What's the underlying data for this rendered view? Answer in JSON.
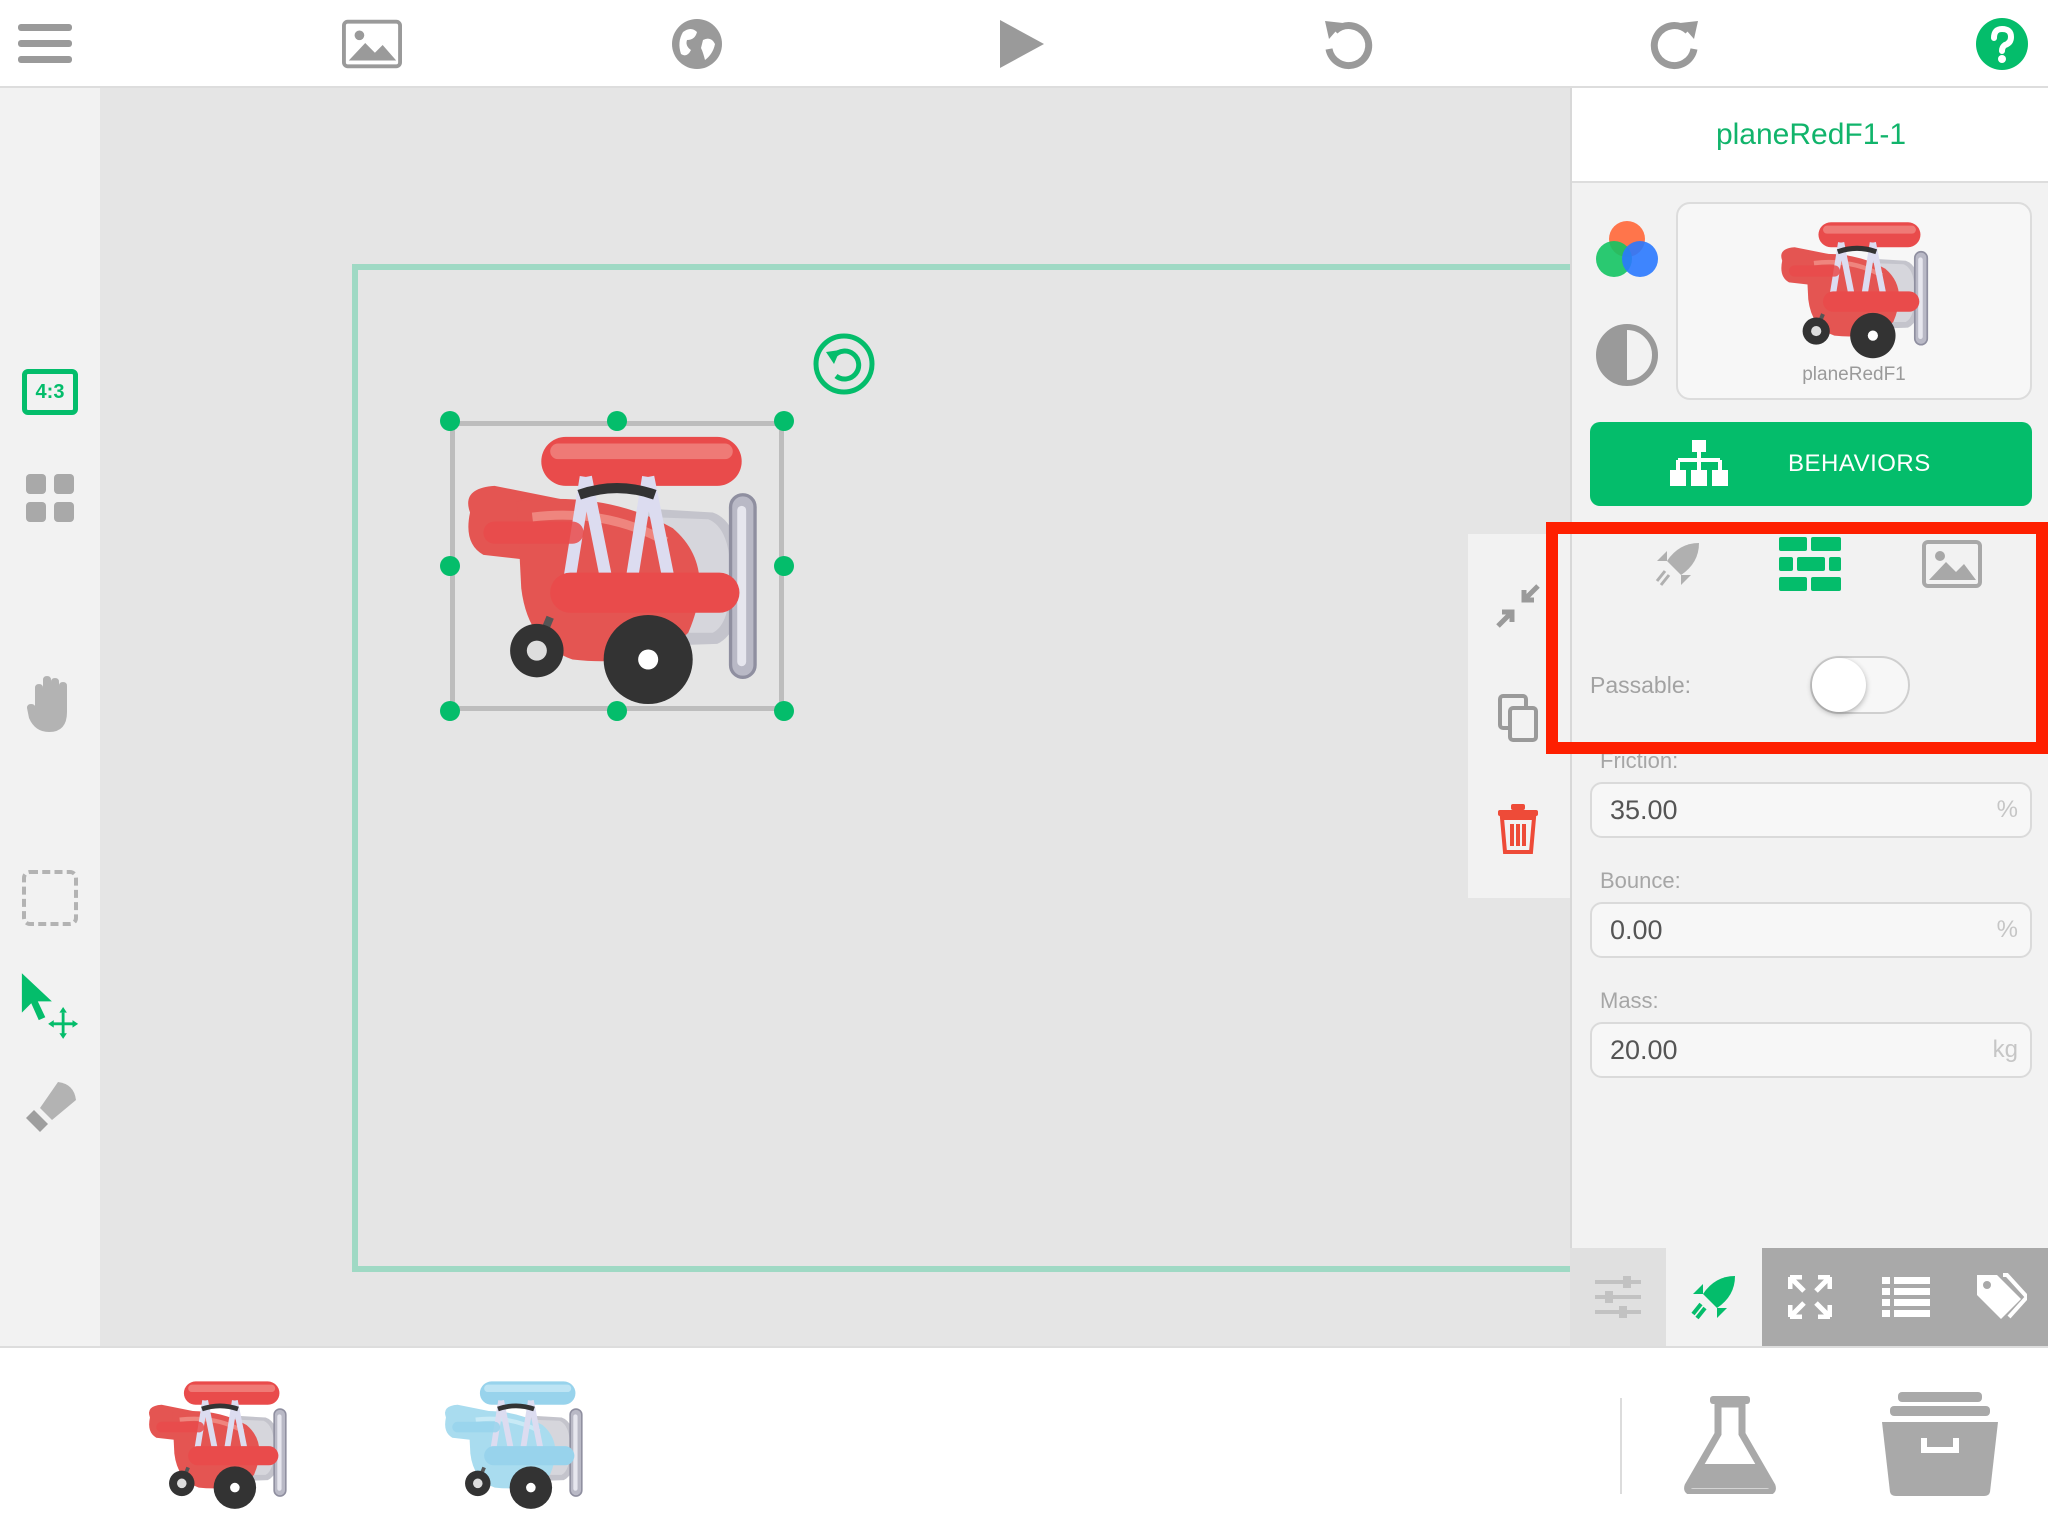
{
  "app": {
    "accent_color": "#04bd6b",
    "highlight_color": "#fe1f00"
  },
  "toolbar": {
    "items": [
      {
        "name": "menu",
        "icon": "hamburger-menu-icon"
      },
      {
        "name": "background",
        "icon": "image-icon"
      },
      {
        "name": "world",
        "icon": "globe-icon"
      },
      {
        "name": "play",
        "icon": "play-icon"
      },
      {
        "name": "undo",
        "icon": "undo-icon"
      },
      {
        "name": "redo",
        "icon": "redo-icon"
      },
      {
        "name": "help",
        "icon": "help-icon"
      }
    ]
  },
  "left_tools": {
    "aspect_label": "4:3",
    "items": [
      {
        "name": "aspect-ratio",
        "icon": "aspect-ratio-icon"
      },
      {
        "name": "grid",
        "icon": "grid-icon"
      },
      {
        "name": "pan",
        "icon": "hand-icon"
      },
      {
        "name": "marquee",
        "icon": "marquee-select-icon"
      },
      {
        "name": "select-move",
        "icon": "select-move-icon"
      },
      {
        "name": "stamp",
        "icon": "stamp-icon"
      }
    ]
  },
  "context_tools": [
    {
      "name": "shrink",
      "icon": "shrink-icon"
    },
    {
      "name": "duplicate",
      "icon": "duplicate-icon"
    },
    {
      "name": "delete",
      "icon": "trash-icon"
    }
  ],
  "inspector": {
    "title": "planeRedF1-1",
    "sprite_name": "planeRedF1",
    "behaviors_label": "BEHAVIORS",
    "sub_tabs": [
      {
        "name": "motion",
        "icon": "rocket-icon",
        "active": false
      },
      {
        "name": "physics",
        "icon": "bricks-icon",
        "active": true
      },
      {
        "name": "appearance",
        "icon": "image-icon",
        "active": false
      }
    ],
    "passable": {
      "label": "Passable:",
      "value": false
    },
    "fields": {
      "friction": {
        "label": "Friction:",
        "value": "35.00",
        "unit": "%"
      },
      "bounce": {
        "label": "Bounce:",
        "value": "0.00",
        "unit": "%"
      },
      "mass": {
        "label": "Mass:",
        "value": "20.00",
        "unit": "kg"
      }
    },
    "bottom_tabs": [
      {
        "name": "properties",
        "icon": "sliders-icon",
        "active": false
      },
      {
        "name": "physics",
        "icon": "rocket-icon",
        "active": true
      },
      {
        "name": "transform",
        "icon": "expand-icon",
        "active": false
      },
      {
        "name": "list",
        "icon": "list-icon",
        "active": false
      },
      {
        "name": "tags",
        "icon": "tags-icon",
        "active": false
      }
    ]
  },
  "assets": [
    {
      "name": "plane-red",
      "icon": "red-plane-icon"
    },
    {
      "name": "plane-blue",
      "icon": "blue-plane-icon"
    }
  ],
  "bottom_actions": [
    {
      "name": "lab",
      "icon": "flask-icon"
    },
    {
      "name": "library",
      "icon": "archive-box-icon"
    }
  ]
}
